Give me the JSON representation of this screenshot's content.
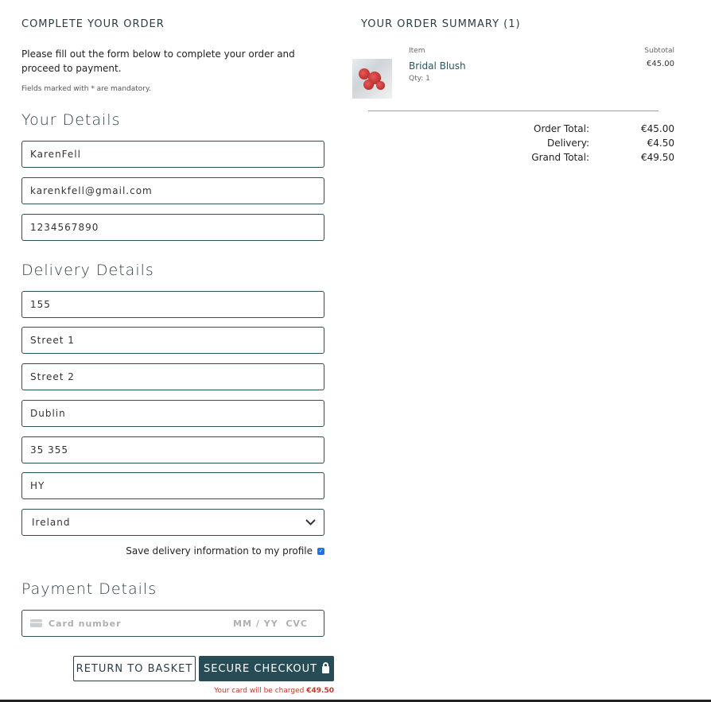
{
  "form": {
    "heading": "COMPLETE YOUR ORDER",
    "intro": "Please fill out the form below to complete your order and proceed to payment.",
    "mandatory_note": "Fields marked with * are mandatory.",
    "your_details": {
      "title": "Your Details",
      "full_name": "KarenFell",
      "email": "karenkfell@gmail.com",
      "phone": "1234567890"
    },
    "delivery_details": {
      "title": "Delivery Details",
      "street_number": "155",
      "street_address1": "Street 1",
      "street_address2": "Street 2",
      "town": "Dublin",
      "postcode": "35 355",
      "county": "HY",
      "country": "Ireland"
    },
    "save_info_label": "Save delivery information to my profile",
    "save_info_checked": true,
    "payment_details": {
      "title": "Payment Details",
      "card_placeholder": "Card number",
      "expiry_cvc_placeholder": "MM / YY  CVC"
    },
    "return_button": "RETURN TO BASKET",
    "checkout_button": "SECURE CHECKOUT",
    "charge_text": "Your card will be charged",
    "charge_amount": "€49.50"
  },
  "summary": {
    "heading": "YOUR ORDER SUMMARY (1)",
    "col_item": "Item",
    "col_subtotal": "Subtotal",
    "items": [
      {
        "name": "Bridal Blush",
        "qty": "Qty: 1",
        "subtotal": "€45.00"
      }
    ],
    "order_total_label": "Order Total:",
    "order_total": "€45.00",
    "delivery_label": "Delivery:",
    "delivery": "€4.50",
    "grand_total_label": "Grand Total:",
    "grand_total": "€49.50"
  },
  "colors": {
    "accent": "#284c55",
    "charge_text": "#c0392b",
    "checkbox": "#1a73e8"
  }
}
